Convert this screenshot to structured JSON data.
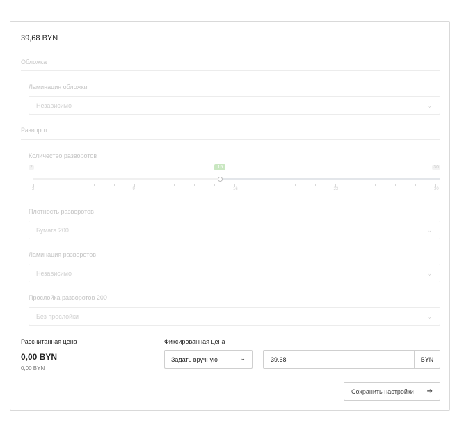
{
  "header": {
    "price": "39,68 BYN"
  },
  "cover": {
    "section_title": "Обложка",
    "lamination": {
      "label": "Ламинация обложки",
      "value": "Независимо"
    }
  },
  "spread": {
    "section_title": "Разворот",
    "count": {
      "label": "Количество разворотов",
      "min_label": "2",
      "max_label": "30",
      "current_label": "15",
      "value": 15,
      "min": 2,
      "max": 30,
      "tick_labels": [
        "2",
        "9",
        "16",
        "23",
        "30"
      ]
    },
    "density": {
      "label": "Плотность разворотов",
      "value": "Бумага 200"
    },
    "lamination": {
      "label": "Ламинация разворотов",
      "value": "Независимо"
    },
    "interlayer": {
      "label": "Прослойка разворотов 200",
      "value": "Без прослойки"
    }
  },
  "calculated": {
    "label": "Рассчитанная цена",
    "value": "0,00 BYN",
    "sub_value": "0,00 BYN"
  },
  "fixed": {
    "label": "Фиксированная цена",
    "mode_value": "Задать вручную",
    "price_value": "39.68",
    "currency": "BYN"
  },
  "actions": {
    "save_label": "Сохранить настройки"
  },
  "icons": {
    "chevron": "chevron-down-icon",
    "arrow": "arrow-right-icon"
  },
  "colors": {
    "slider_bubble": "#c9e7c1",
    "border": "#d9d9d9"
  }
}
